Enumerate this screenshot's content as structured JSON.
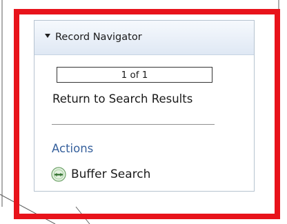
{
  "panel": {
    "title": "Record Navigator",
    "collapse_icon": "triangle-down-icon"
  },
  "navigator": {
    "pager_text": "1 of 1",
    "return_link": "Return to Search Results"
  },
  "actions": {
    "heading": "Actions",
    "items": [
      {
        "label": "Buffer Search",
        "icon": "buffer-search-icon"
      }
    ]
  },
  "colors": {
    "highlight_border": "#e8131b",
    "link_blue": "#36609c",
    "header_bg_top": "#f6f9fd",
    "header_bg_bottom": "#dfe8f4",
    "panel_border": "#b6c3d0"
  }
}
